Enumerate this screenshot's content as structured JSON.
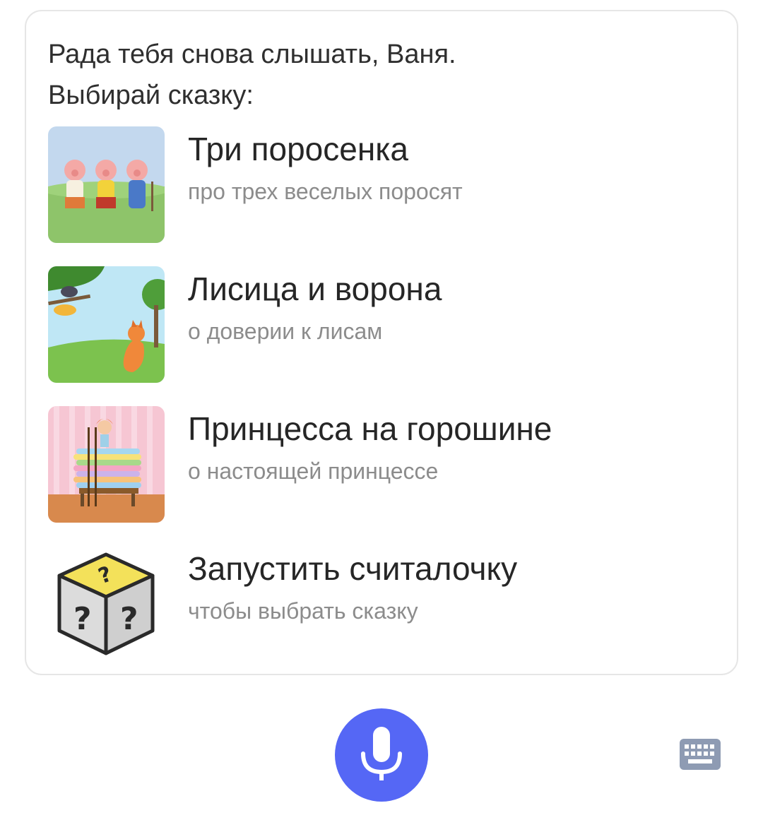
{
  "greeting": {
    "line1": "Рада тебя снова слышать, Ваня.",
    "line2": "Выбирай сказку:"
  },
  "items": [
    {
      "title": "Три поросенка",
      "subtitle": "про трех веселых поросят",
      "icon": "three-pigs-thumbnail"
    },
    {
      "title": "Лисица и ворона",
      "subtitle": "о доверии к лисам",
      "icon": "fox-and-crow-thumbnail"
    },
    {
      "title": "Принцесса на горошине",
      "subtitle": "о настоящей принцессе",
      "icon": "princess-pea-thumbnail"
    },
    {
      "title": "Запустить считалочку",
      "subtitle": "чтобы выбрать сказку",
      "icon": "question-dice-thumbnail"
    }
  ],
  "controls": {
    "mic_icon": "microphone-icon",
    "keyboard_icon": "keyboard-icon",
    "accent_color": "#5567f5"
  }
}
